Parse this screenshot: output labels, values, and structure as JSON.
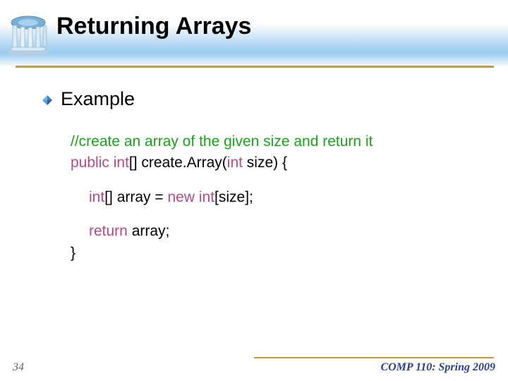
{
  "slide": {
    "title": "Returning Arrays",
    "bullet": "Example",
    "comment": "//create an array of the given size and return it",
    "kw_public": "public",
    "kw_int1": "int",
    "sig_after_int1": "[] create.Array(",
    "kw_int2": "int",
    "sig_after_int2": " size)  {",
    "kw_int3": "int",
    "line2_mid": "[] array = ",
    "kw_new": "new",
    "line2_space": " ",
    "kw_int4": "int",
    "line2_end": "[size];",
    "kw_return": "return",
    "line3_end": " array;",
    "close_brace": "}",
    "page_number": "34",
    "footer": "COMP 110: Spring 2009"
  }
}
